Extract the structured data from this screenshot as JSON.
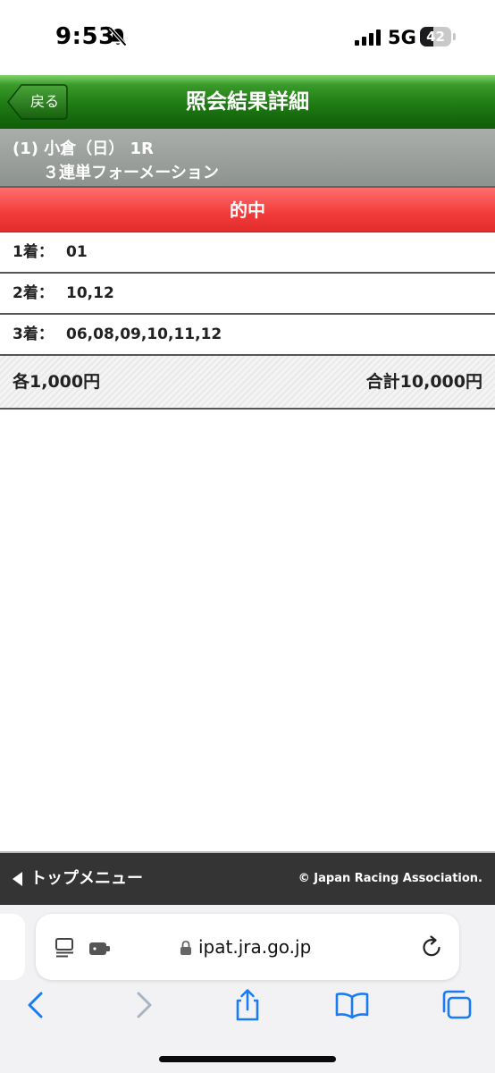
{
  "status_bar": {
    "time": "9:53",
    "network": "5G",
    "battery_level": "42",
    "battery_percent": 42
  },
  "header": {
    "back_label": "戻る",
    "title": "照会結果詳細"
  },
  "race": {
    "line1": "(1) 小倉（日） 1R",
    "line2": "３連単フォーメーション"
  },
  "result": {
    "status": "的中",
    "rows": [
      {
        "label": "1着：",
        "value": "01"
      },
      {
        "label": "2着：",
        "value": "10,12"
      },
      {
        "label": "3着：",
        "value": "06,08,09,10,11,12"
      }
    ],
    "each_amount": "各1,000円",
    "total_amount": "合計10,000円"
  },
  "footer": {
    "top_menu_label": "トップメニュー",
    "copyright": "© Japan Racing Association."
  },
  "browser": {
    "url": "ipat.jra.go.jp"
  },
  "colors": {
    "header_green": "#1f7a14",
    "hit_red": "#f23a3a",
    "race_gray": "#8e9390",
    "footer_dark": "#343434",
    "safari_blue": "#1a7cf5"
  }
}
